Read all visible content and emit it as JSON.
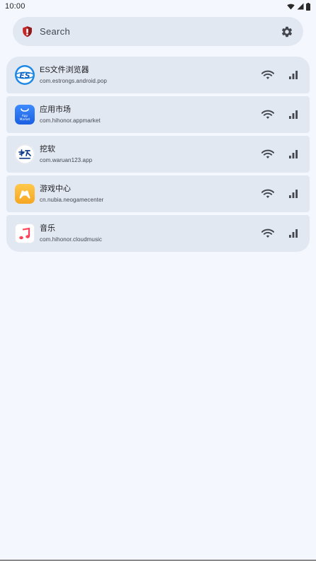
{
  "status_bar": {
    "time": "10:00"
  },
  "search": {
    "placeholder": "Search",
    "shield_icon": "shield-icon",
    "settings_icon": "gear-icon",
    "shield_color": "#c62828"
  },
  "apps": [
    {
      "name": "ES文件浏览器",
      "package": "com.estrongs.android.pop",
      "icon": "es-file-explorer-icon"
    },
    {
      "name": "应用市场",
      "package": "com.hihonor.appmarket",
      "icon": "app-market-icon"
    },
    {
      "name": "挖软",
      "package": "com.waruan123.app",
      "icon": "waruan-icon"
    },
    {
      "name": "游戏中心",
      "package": "cn.nubia.neogamecenter",
      "icon": "game-center-icon"
    },
    {
      "name": "音乐",
      "package": "com.hihonor.cloudmusic",
      "icon": "music-icon"
    }
  ],
  "colors": {
    "background": "#f4f8fe",
    "card": "#e2e8f2",
    "icon": "#44474e"
  }
}
